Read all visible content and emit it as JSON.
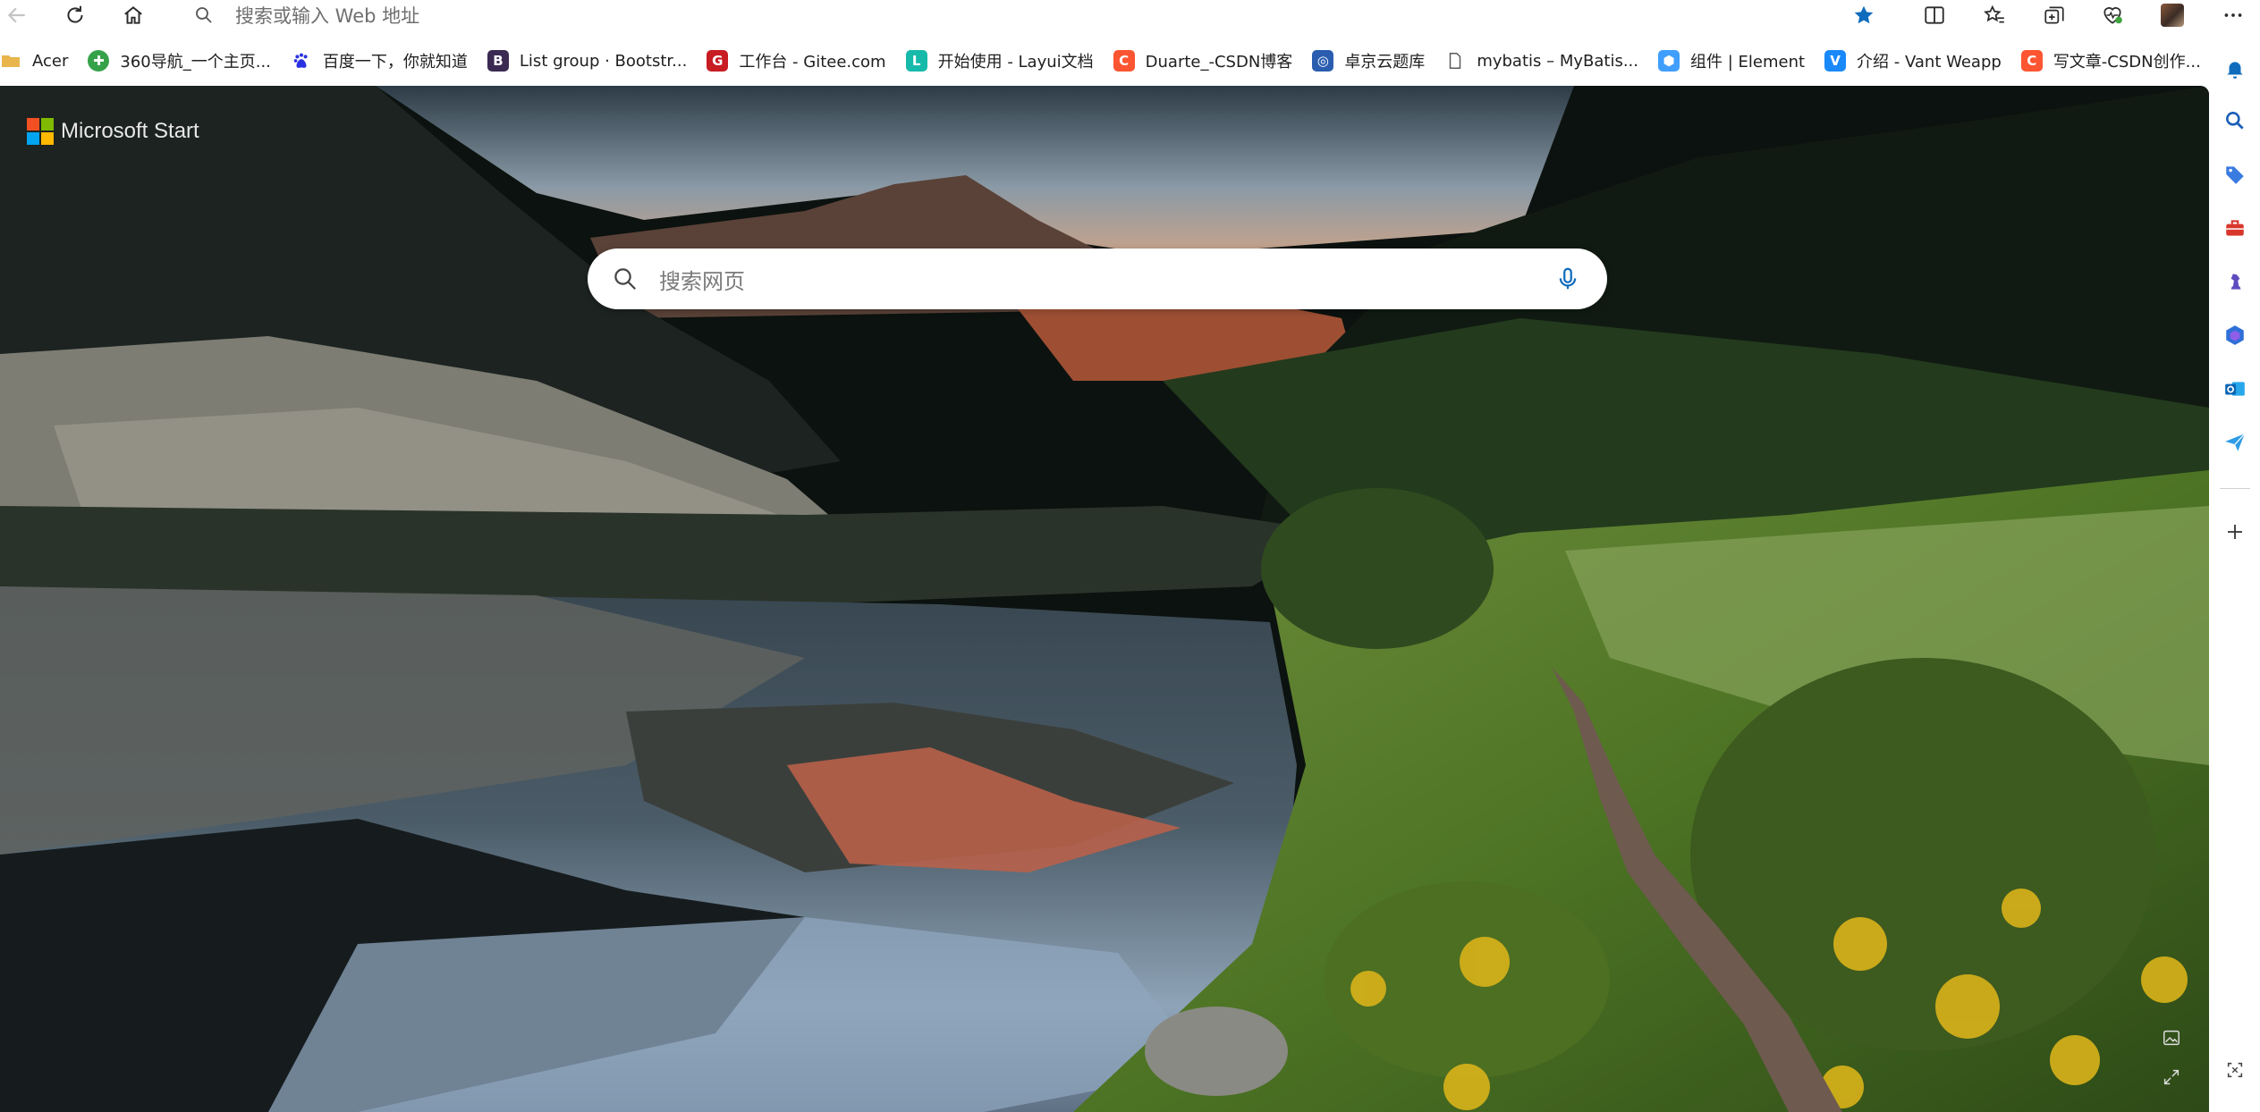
{
  "toolbar": {
    "address_placeholder": "搜索或输入 Web 地址"
  },
  "favorites": [
    {
      "label": "Acer",
      "icon": "folder-icon",
      "color": "#e8b64c"
    },
    {
      "label": "360导航_一个主页...",
      "icon": "360-icon",
      "color": "#35a24a"
    },
    {
      "label": "百度一下，你就知道",
      "icon": "baidu-paw-icon",
      "color": "#2932e1"
    },
    {
      "label": "List group · Bootstr...",
      "icon": "bootstrap-icon",
      "color": "#3b2a52"
    },
    {
      "label": "工作台 - Gitee.com",
      "icon": "gitee-icon",
      "color": "#c71d23"
    },
    {
      "label": "开始使用 - Layui文档",
      "icon": "layui-icon",
      "color": "#16baaa"
    },
    {
      "label": "Duarte_-CSDN博客",
      "icon": "csdn-icon",
      "color": "#fc5531"
    },
    {
      "label": "卓京云题库",
      "icon": "globe-icon",
      "color": "#2a5db0"
    },
    {
      "label": "mybatis – MyBatis...",
      "icon": "page-icon",
      "color": "#5a5a5a"
    },
    {
      "label": "组件 | Element",
      "icon": "element-icon",
      "color": "#409eff"
    },
    {
      "label": "介绍 - Vant Weapp",
      "icon": "vant-icon",
      "color": "#1989fa"
    },
    {
      "label": "写文章-CSDN创作...",
      "icon": "csdn-icon",
      "color": "#fc5531"
    }
  ],
  "content": {
    "brand": "Microsoft Start",
    "search_placeholder": "搜索网页"
  },
  "colors": {
    "accent": "#0f6cbd",
    "ms_red": "#f25022",
    "ms_green": "#7fba00",
    "ms_blue": "#00a4ef",
    "ms_yellow": "#ffb900"
  }
}
